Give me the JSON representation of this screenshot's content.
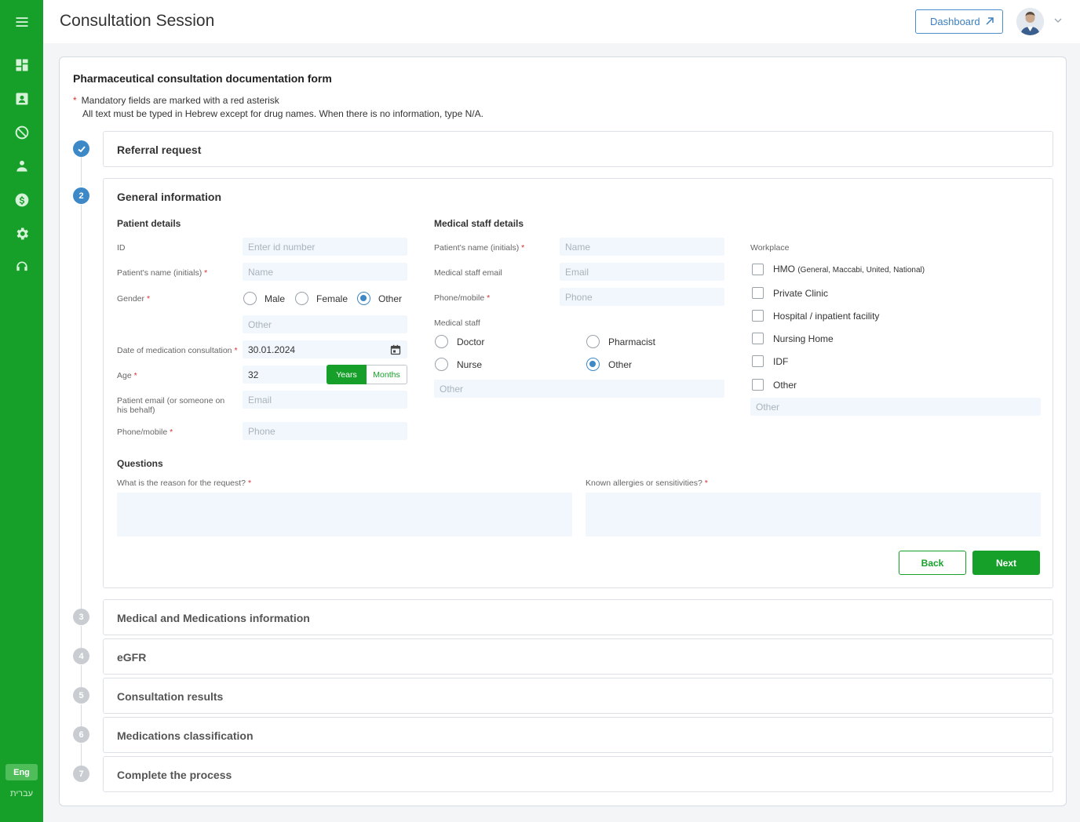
{
  "header": {
    "title": "Consultation Session",
    "dashboard_label": "Dashboard"
  },
  "sidebar": {
    "icons": [
      "menu-icon",
      "dashboard-icon",
      "contacts-icon",
      "blocked-icon",
      "team-icon",
      "billing-icon",
      "settings-icon",
      "support-icon"
    ],
    "lang_en": "Eng",
    "lang_he": "עברית"
  },
  "form": {
    "title": "Pharmaceutical consultation documentation form",
    "asterisk": "*",
    "note_mandatory": "Mandatory fields are marked with a red asterisk",
    "note_hebrew": "All text must be typed in Hebrew except for drug names. When there is no information, type N/A."
  },
  "steps": [
    {
      "number": "1",
      "title": "Referral request",
      "status": "done"
    },
    {
      "number": "2",
      "title": "General information",
      "status": "active"
    },
    {
      "number": "3",
      "title": "Medical and Medications information",
      "status": "idle"
    },
    {
      "number": "4",
      "title": "eGFR",
      "status": "idle"
    },
    {
      "number": "5",
      "title": "Consultation results",
      "status": "idle"
    },
    {
      "number": "6",
      "title": "Medications classification",
      "status": "idle"
    },
    {
      "number": "7",
      "title": "Complete the process",
      "status": "idle"
    }
  ],
  "patient": {
    "heading": "Patient details",
    "id_label": "ID",
    "id_placeholder": "Enter id number",
    "name_label": "Patient's name (initials)",
    "name_placeholder": "Name",
    "gender_label": "Gender",
    "gender_options": [
      "Male",
      "Female",
      "Other"
    ],
    "gender_selected": "Other",
    "gender_other_placeholder": "Other",
    "date_label": "Date of medication consultation",
    "date_value": "30.01.2024",
    "age_label": "Age",
    "age_value": "32",
    "age_unit_years": "Years",
    "age_unit_months": "Months",
    "age_unit_selected": "Years",
    "email_label": "Patient email (or someone on his behalf)",
    "email_placeholder": "Email",
    "phone_label": "Phone/mobile",
    "phone_placeholder": "Phone"
  },
  "staff": {
    "heading": "Medical staff details",
    "name_label": "Patient's name (initials)",
    "name_placeholder": "Name",
    "email_label": "Medical staff email",
    "email_placeholder": "Email",
    "phone_label": "Phone/mobile",
    "phone_placeholder": "Phone",
    "staff_label": "Medical staff",
    "staff_options": [
      "Doctor",
      "Pharmacist",
      "Nurse",
      "Other"
    ],
    "staff_selected": "Other",
    "staff_other_placeholder": "Other"
  },
  "workplace": {
    "label": "Workplace",
    "hmo_label": "HMO",
    "hmo_note": "(General, Maccabi, United, National)",
    "options": [
      "Private Clinic",
      "Hospital / inpatient facility",
      "Nursing Home",
      "IDF",
      "Other"
    ],
    "other_placeholder": "Other"
  },
  "questions": {
    "heading": "Questions",
    "reason_label": "What is the reason for the request?",
    "allergies_label": "Known allergies or sensitivities?"
  },
  "actions": {
    "back": "Back",
    "next": "Next"
  },
  "colors": {
    "brand_green": "#16a02a",
    "accent_blue": "#3d88c7",
    "required_red": "#e03030",
    "input_bg": "#f1f7fd"
  }
}
